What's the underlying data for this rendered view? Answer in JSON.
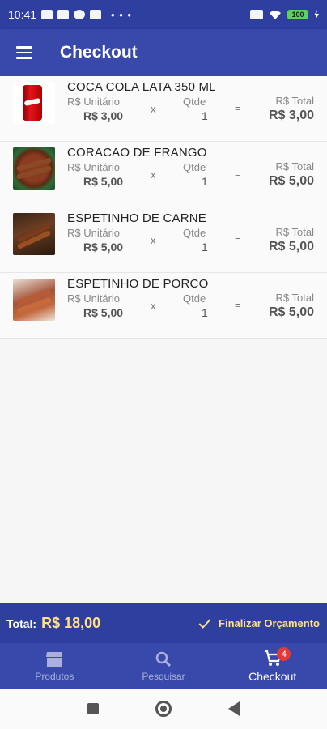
{
  "status_bar": {
    "time": "10:41",
    "battery": "100"
  },
  "app_bar": {
    "title": "Checkout"
  },
  "items": [
    {
      "name": "COCA COLA LATA 350 ML",
      "unit_label": "R$ Unitário",
      "unit_value": "R$ 3,00",
      "op_x": "x",
      "qty_label": "Qtde",
      "qty_value": "1",
      "op_eq": "=",
      "total_label": "R$ Total",
      "total_value": "R$ 3,00",
      "image_icon": "soda-can-image"
    },
    {
      "name": "CORACAO DE FRANGO",
      "unit_label": "R$ Unitário",
      "unit_value": "R$ 5,00",
      "op_x": "x",
      "qty_label": "Qtde",
      "qty_value": "1",
      "op_eq": "=",
      "total_label": "R$ Total",
      "total_value": "R$ 5,00",
      "image_icon": "chicken-heart-image"
    },
    {
      "name": "ESPETINHO DE CARNE",
      "unit_label": "R$ Unitário",
      "unit_value": "R$ 5,00",
      "op_x": "x",
      "qty_label": "Qtde",
      "qty_value": "1",
      "op_eq": "=",
      "total_label": "R$ Total",
      "total_value": "R$ 5,00",
      "image_icon": "beef-skewer-image"
    },
    {
      "name": "ESPETINHO DE PORCO",
      "unit_label": "R$ Unitário",
      "unit_value": "R$ 5,00",
      "op_x": "x",
      "qty_label": "Qtde",
      "qty_value": "1",
      "op_eq": "=",
      "total_label": "R$ Total",
      "total_value": "R$ 5,00",
      "image_icon": "pork-skewer-image"
    }
  ],
  "total_bar": {
    "caption": "Total:",
    "amount": "R$ 18,00",
    "finalize_label": "Finalizar Orçamento"
  },
  "bottom_nav": {
    "items": [
      {
        "label": "Produtos",
        "icon": "store-icon"
      },
      {
        "label": "Pesquisar",
        "icon": "search-icon"
      },
      {
        "label": "Checkout",
        "icon": "cart-icon",
        "badge": "4"
      }
    ]
  },
  "colors": {
    "primary": "#3949ab",
    "primary_dark": "#2f3f9f",
    "accent": "#ffe082",
    "badge": "#e53935"
  }
}
